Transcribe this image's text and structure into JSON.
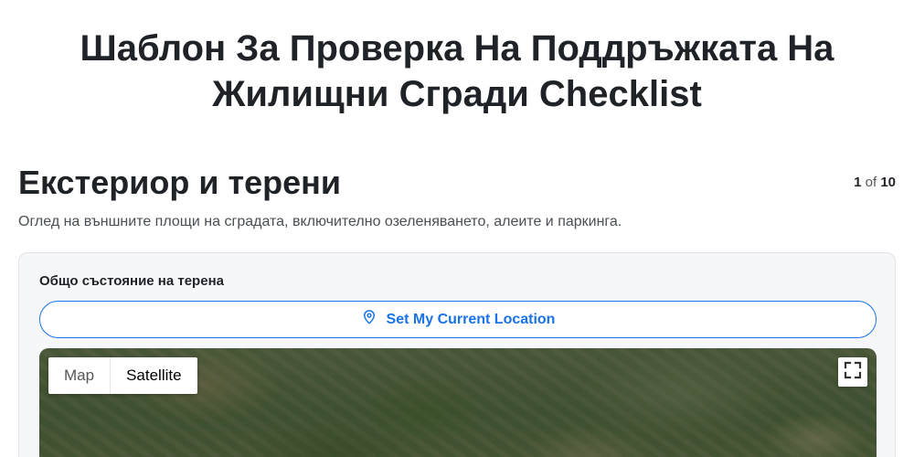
{
  "page": {
    "title": "Шаблон За Проверка На Поддръжката На Жилищни Сгради Checklist"
  },
  "section": {
    "title": "Екстериор и терени",
    "description": "Оглед на външните площи на сградата, включително озеленяването, алеите и паркинга.",
    "pager": {
      "current": "1",
      "of_label": "of",
      "total": "10"
    }
  },
  "field": {
    "label": "Общо състояние на терена",
    "location_button_label": "Set My Current Location",
    "location_icon": "location-pin-icon"
  },
  "map": {
    "options": [
      "Map",
      "Satellite"
    ],
    "selected": "Satellite",
    "fullscreen_icon": "fullscreen-icon"
  },
  "colors": {
    "accent": "#1a73e8",
    "text": "#1f2328",
    "card_bg": "#f6f7f9"
  }
}
